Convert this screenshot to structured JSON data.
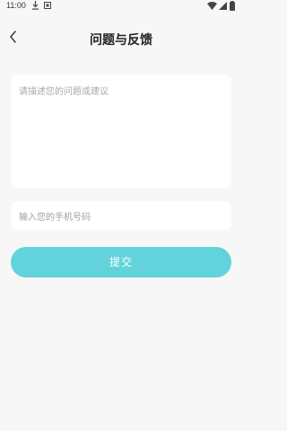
{
  "status_bar": {
    "time": "11:00",
    "icons": [
      "download-icon",
      "notification-icon",
      "wifi-icon",
      "signal-icon",
      "battery-icon"
    ]
  },
  "header": {
    "title": "问题与反馈",
    "back_icon": "chevron-left-icon"
  },
  "form": {
    "feedback_placeholder": "请描述您的问题或建议",
    "phone_placeholder": "输入您的手机号码",
    "submit_label": "提交"
  },
  "colors": {
    "background": "#f7f7f7",
    "accent": "#62d3da",
    "placeholder": "#a8a8a8"
  }
}
